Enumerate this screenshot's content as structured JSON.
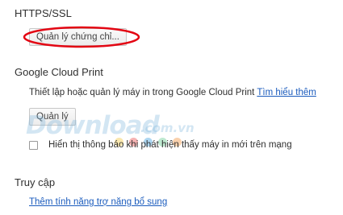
{
  "https": {
    "title": "HTTPS/SSL",
    "manage_certificates_label": "Quản lý chứng chỉ..."
  },
  "cloud_print": {
    "title": "Google Cloud Print",
    "description": "Thiết lập hoặc quản lý máy in trong Google Cloud Print",
    "learn_more": "Tìm hiểu thêm",
    "manage_label": "Quản lý",
    "notify_checkbox_label": "Hiển thị thông báo khi phát hiện thấy máy in mới trên mạng",
    "notify_checked": false
  },
  "accessibility": {
    "title": "Truy cập",
    "add_features_link": "Thêm tính năng trợ năng bổ sung"
  },
  "watermark": {
    "word": "Download",
    "domain": ".com.vn",
    "dot_colors": [
      "#f2c94c",
      "#eb5757",
      "#4aa3df",
      "#6fcf97",
      "#f2994a"
    ]
  },
  "colors": {
    "highlight": "#e30613",
    "link": "#1a5bbd"
  }
}
